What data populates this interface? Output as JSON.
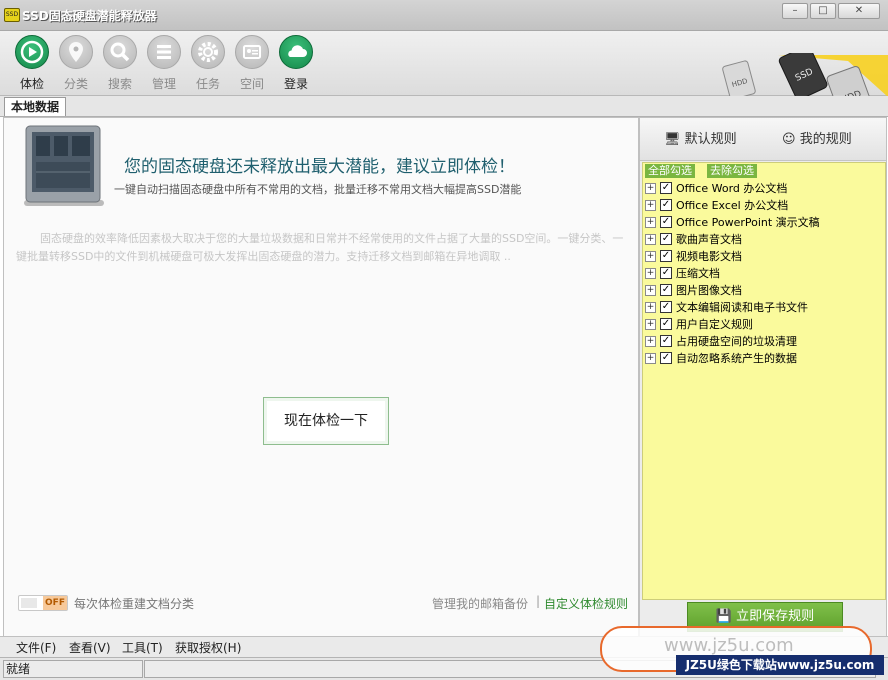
{
  "window": {
    "title": "SSD固态硬盘潜能释放器",
    "icon_label": "SSD",
    "minimize_icon": "minimize-icon",
    "maximize_icon": "maximize-icon",
    "close_icon": "close-icon"
  },
  "toolbar": {
    "items": [
      {
        "label": "体检",
        "icon": "play-icon",
        "active": true
      },
      {
        "label": "分类",
        "icon": "location-pin-icon",
        "active": false
      },
      {
        "label": "搜索",
        "icon": "search-icon",
        "active": false
      },
      {
        "label": "管理",
        "icon": "list-icon",
        "active": false
      },
      {
        "label": "任务",
        "icon": "gear-icon",
        "active": false
      },
      {
        "label": "空间",
        "icon": "id-card-icon",
        "active": false
      },
      {
        "label": "登录",
        "icon": "cloud-icon",
        "active": true
      }
    ],
    "decor_labels": [
      "HDD",
      "SSD",
      "HDD"
    ]
  },
  "tabs": {
    "active": "本地数据"
  },
  "main": {
    "headline": "您的固态硬盘还未释放出最大潜能，建议立即体检！",
    "subline": "一键自动扫描固态硬盘中所有不常用的文档，批量迁移不常用文档大幅提高SSD潜能",
    "description": "固态硬盘的效率降低因素极大取决于您的大量垃圾数据和日常并不经常使用的文件占据了大量的SSD空间。一键分类、一键批量转移SSD中的文件到机械硬盘可极大发挥出固态硬盘的潜力。支持迁移文档到邮箱在异地调取 ..",
    "scan_button": "现在体检一下",
    "toggle_state": "OFF",
    "toggle_label": "每次体检重建文档分类",
    "manage_mail_link": "管理我的邮箱备份",
    "link_separator": "|",
    "custom_rules_link": "自定义体检规则"
  },
  "rules_panel": {
    "tab_default": "默认规则",
    "tab_mine": "我的规则",
    "select_all": "全部勾选",
    "clear_all": "去除勾选",
    "rules": [
      {
        "label": "Office Word 办公文档",
        "checked": true
      },
      {
        "label": "Office Excel 办公文档",
        "checked": true
      },
      {
        "label": "Office PowerPoint 演示文稿",
        "checked": true
      },
      {
        "label": "歌曲声音文档",
        "checked": true
      },
      {
        "label": "视频电影文档",
        "checked": true
      },
      {
        "label": "压缩文档",
        "checked": true
      },
      {
        "label": "图片图像文档",
        "checked": true
      },
      {
        "label": "文本编辑阅读和电子书文件",
        "checked": true
      },
      {
        "label": "用户自定义规则",
        "checked": true
      },
      {
        "label": "占用硬盘空间的垃圾清理",
        "checked": true
      },
      {
        "label": "自动忽略系统产生的数据",
        "checked": true
      }
    ],
    "save_button": "立即保存规则"
  },
  "menubar": {
    "items": [
      "文件(F)",
      "查看(V)",
      "工具(T)",
      "获取授权(H)"
    ]
  },
  "status": {
    "text": "就绪"
  },
  "watermark": {
    "site": "www.jz5u.com",
    "banner": "JZ5U绿色下载站www.jz5u.com"
  },
  "colors": {
    "accent_green": "#15884a",
    "rule_area_bg": "#fafa9c",
    "save_button": "#6aad34",
    "headline": "#1f5f6e"
  }
}
